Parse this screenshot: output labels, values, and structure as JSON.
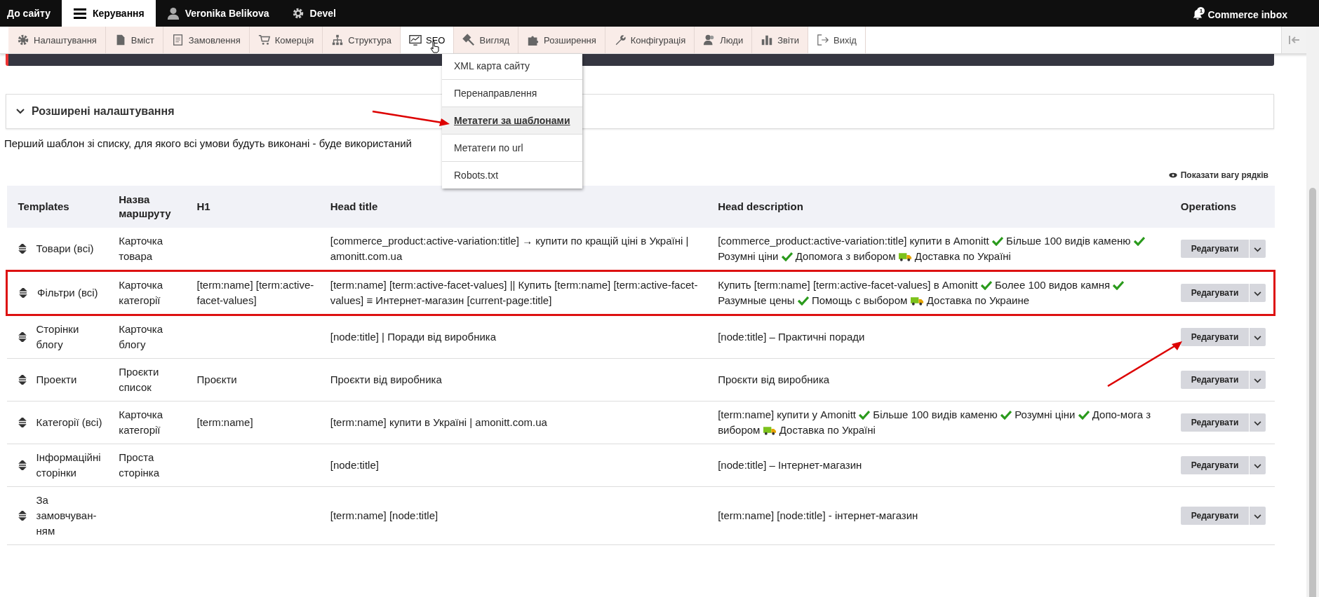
{
  "top_bar": {
    "items": [
      {
        "label": "До сайту",
        "selected": false
      },
      {
        "label": "Керування",
        "selected": true
      },
      {
        "label": "Veronika Belikova",
        "selected": false
      },
      {
        "label": "Devel",
        "selected": false
      }
    ],
    "inbox": {
      "label": "Commerce inbox",
      "badge": "1"
    }
  },
  "toolbar": {
    "items": [
      {
        "label": "Налаштування",
        "selected": false
      },
      {
        "label": "Вміст",
        "selected": false
      },
      {
        "label": "Замовлення",
        "selected": false
      },
      {
        "label": "Комерція",
        "selected": false
      },
      {
        "label": "Структура",
        "selected": false
      },
      {
        "label": "SEO",
        "selected": true
      },
      {
        "label": "Вигляд",
        "selected": false
      },
      {
        "label": "Розширення",
        "selected": false
      },
      {
        "label": "Конфігурація",
        "selected": false
      },
      {
        "label": "Люди",
        "selected": false
      },
      {
        "label": "Звіти",
        "selected": false
      },
      {
        "label": "Вихід",
        "selected": false
      }
    ]
  },
  "dropdown": {
    "items": [
      {
        "label": "XML карта сайту",
        "selected": false
      },
      {
        "label": "Перенаправлення",
        "selected": false
      },
      {
        "label": "Метатеги за шаблонами",
        "selected": true
      },
      {
        "label": "Метатеги по url",
        "selected": false
      },
      {
        "label": "Robots.txt",
        "selected": false
      }
    ]
  },
  "details": {
    "title": "Розширені налаштування",
    "expanded": true
  },
  "intro": "Перший шаблон зі списку, для якого всі умови будуть виконані - буде використаний",
  "weights_link": "Показати вагу рядків",
  "table": {
    "columns": [
      "Templates",
      "Назва маршруту",
      "H1",
      "Head title",
      "Head description",
      "Operations"
    ],
    "rows": [
      {
        "template": "Товари (всі)",
        "route": "Карточка товара",
        "h1": "",
        "title": "[commerce_product:active-variation:title] → купити по кращій ціні в Україні | amonitt.com.ua",
        "description": [
          {
            "kind": "text",
            "text": "[commerce_product:active-variation:title] купити в Amonitt "
          },
          {
            "kind": "check"
          },
          {
            "kind": "text",
            "text": " Більше 100 видів каменю "
          },
          {
            "kind": "check"
          },
          {
            "kind": "text",
            "text": " Розумні ціни "
          },
          {
            "kind": "check"
          },
          {
            "kind": "text",
            "text": " Допомога з вибором "
          },
          {
            "kind": "truck"
          },
          {
            "kind": "text",
            "text": " Доставка по Україні"
          }
        ],
        "button": "Редагувати",
        "highlighted": false
      },
      {
        "template": "Фільтри (всі)",
        "route": "Карточка категорії",
        "h1": "[term:name] [term:active-facet-values]",
        "title": "[term:name] [term:active-facet-values] || Купить [term:name] [term:active-facet-values] ≡ Интернет-магазин [current-page:title]",
        "description": [
          {
            "kind": "text",
            "text": "Купить [term:name] [term:active-facet-values] в Amonitt "
          },
          {
            "kind": "check"
          },
          {
            "kind": "text",
            "text": " Более 100 видов камня "
          },
          {
            "kind": "check"
          },
          {
            "kind": "text",
            "text": " Разумные цены "
          },
          {
            "kind": "check"
          },
          {
            "kind": "text",
            "text": " Помощь с выбором "
          },
          {
            "kind": "truck"
          },
          {
            "kind": "text",
            "text": " Доставка по Украине"
          }
        ],
        "button": "Редагувати",
        "highlighted": true
      },
      {
        "template": "Сторінки блогу",
        "route": "Карточка блогу",
        "h1": "",
        "title": "[node:title] | Поради від виробника",
        "description": [
          {
            "kind": "text",
            "text": "[node:title] – Практичні поради"
          }
        ],
        "button": "Редагувати",
        "highlighted": false
      },
      {
        "template": "Проекти",
        "route": "Проєкти список",
        "h1": "Проєкти",
        "title": "Проєкти від виробника",
        "description": [
          {
            "kind": "text",
            "text": "Проєкти від виробника"
          }
        ],
        "button": "Редагувати",
        "highlighted": false
      },
      {
        "template": "Категорії (всі)",
        "route": "Карточка категорії",
        "h1": "[term:name]",
        "title": "[term:name] купити в Україні | amonitt.com.ua",
        "description": [
          {
            "kind": "text",
            "text": "[term:name] купити у Amonitt "
          },
          {
            "kind": "check"
          },
          {
            "kind": "text",
            "text": " Більше 100 видів каменю "
          },
          {
            "kind": "check"
          },
          {
            "kind": "text",
            "text": " Розумні ціни "
          },
          {
            "kind": "check"
          },
          {
            "kind": "text",
            "text": " Допо-мога з вибором "
          },
          {
            "kind": "truck"
          },
          {
            "kind": "text",
            "text": " Доставка по Україні"
          }
        ],
        "button": "Редагувати",
        "highlighted": false
      },
      {
        "template": "Інформаційні сторінки",
        "route": "Проста сторінка",
        "h1": "",
        "title": "[node:title]",
        "description": [
          {
            "kind": "text",
            "text": "[node:title] – Інтернет-магазин"
          }
        ],
        "button": "Редагувати",
        "highlighted": false
      },
      {
        "template": "За замовчуван-ням",
        "route": "",
        "h1": "",
        "title": "[term:name] [node:title]",
        "description": [
          {
            "kind": "text",
            "text": "[term:name] [node:title] - інтернет-магазин"
          }
        ],
        "button": "Редагувати",
        "highlighted": false
      }
    ]
  }
}
